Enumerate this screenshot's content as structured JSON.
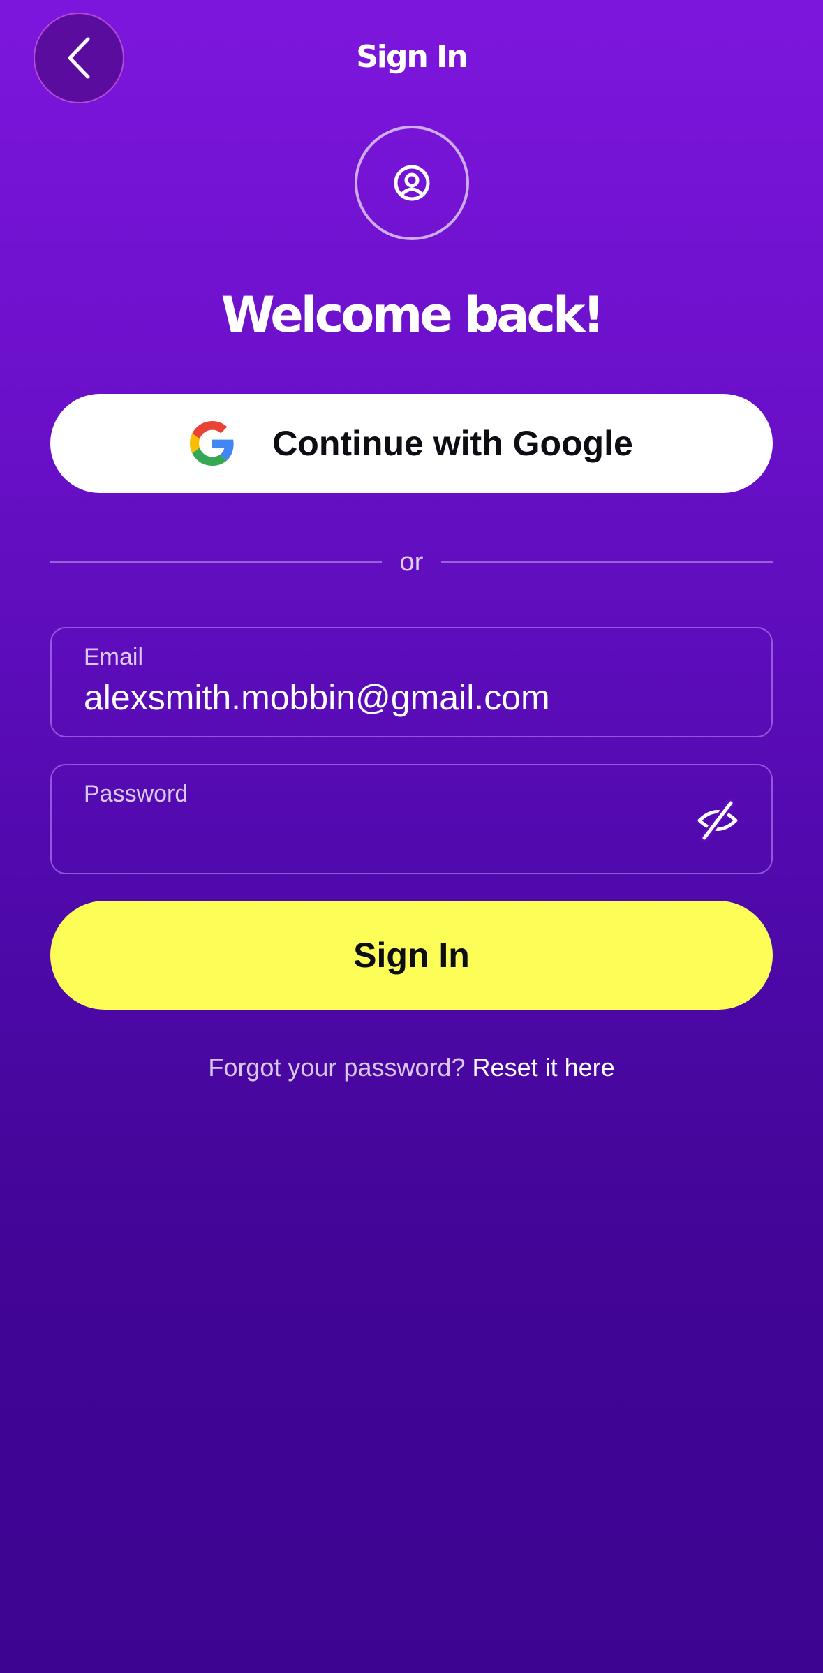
{
  "header": {
    "title": "Sign In",
    "back_icon": "chevron-left-icon"
  },
  "avatar": {
    "icon": "user-circle-icon"
  },
  "welcome": {
    "heading": "Welcome back!"
  },
  "google": {
    "label": "Continue with Google",
    "icon": "google-icon"
  },
  "divider": {
    "text": "or"
  },
  "form": {
    "email": {
      "label": "Email",
      "value": "alexsmith.mobbin@gmail.com"
    },
    "password": {
      "label": "Password",
      "value": "",
      "toggle_icon": "eye-off-icon"
    },
    "submit_label": "Sign In"
  },
  "forgot": {
    "prompt": "Forgot your password?",
    "link": "Reset it here"
  },
  "colors": {
    "background_top": "#7d16dd",
    "background_bottom": "#3d0491",
    "primary_button": "#fdfd58",
    "google_button": "#ffffff"
  }
}
